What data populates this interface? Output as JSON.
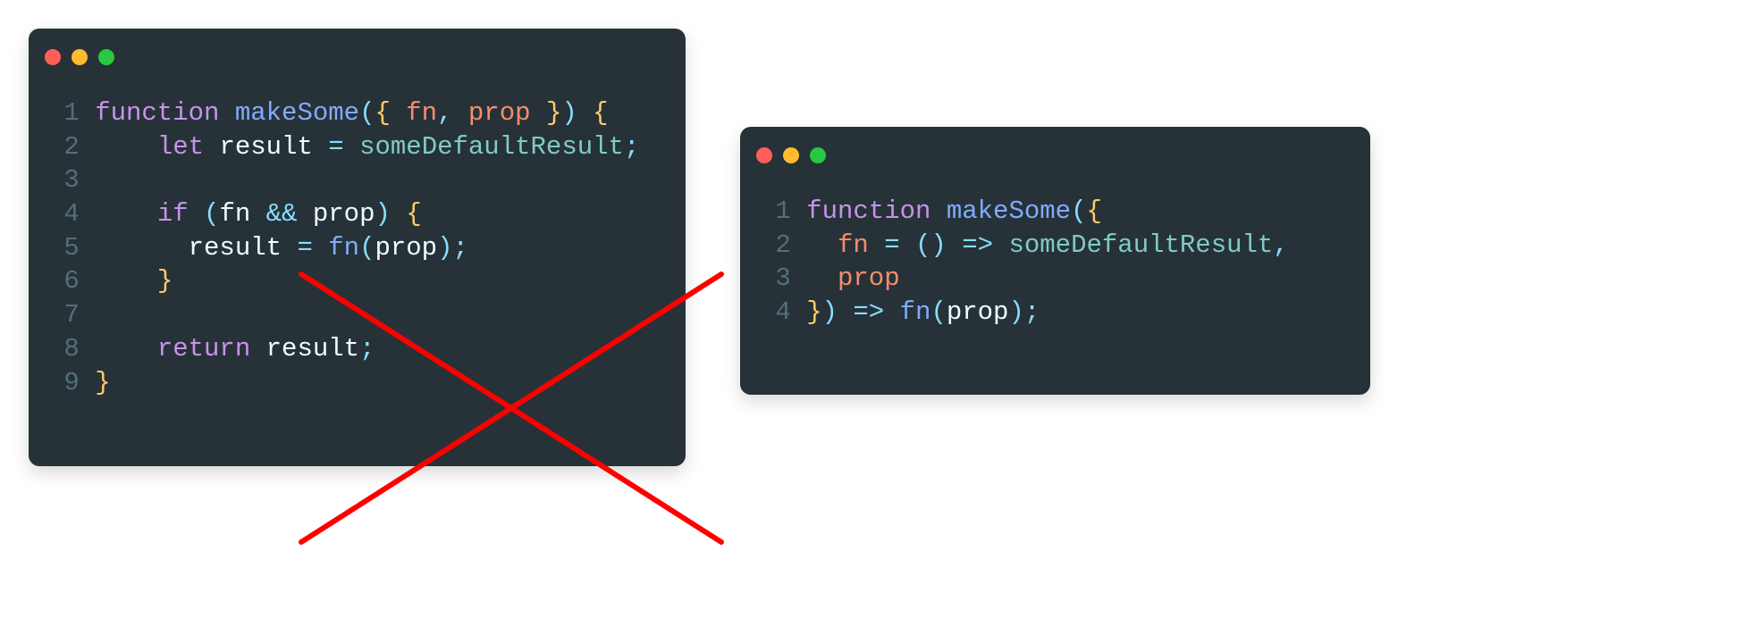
{
  "windows": {
    "left": {
      "titlebar_dots": [
        "close",
        "minimize",
        "zoom"
      ],
      "crossed_out": true,
      "code_lines": [
        {
          "n": 1,
          "tokens": [
            {
              "cls": "kw",
              "t": "function"
            },
            {
              "cls": "tok",
              "t": " "
            },
            {
              "cls": "fn",
              "t": "makeSome"
            },
            {
              "cls": "punct",
              "t": "("
            },
            {
              "cls": "brace",
              "t": "{"
            },
            {
              "cls": "tok",
              "t": " "
            },
            {
              "cls": "param",
              "t": "fn"
            },
            {
              "cls": "punct",
              "t": ","
            },
            {
              "cls": "tok",
              "t": " "
            },
            {
              "cls": "param",
              "t": "prop"
            },
            {
              "cls": "tok",
              "t": " "
            },
            {
              "cls": "brace",
              "t": "}"
            },
            {
              "cls": "punct",
              "t": ")"
            },
            {
              "cls": "tok",
              "t": " "
            },
            {
              "cls": "brace",
              "t": "{"
            }
          ]
        },
        {
          "n": 2,
          "tokens": [
            {
              "cls": "tok",
              "t": "    "
            },
            {
              "cls": "kw",
              "t": "let"
            },
            {
              "cls": "tok",
              "t": " "
            },
            {
              "cls": "id",
              "t": "result"
            },
            {
              "cls": "tok",
              "t": " "
            },
            {
              "cls": "punct",
              "t": "="
            },
            {
              "cls": "tok",
              "t": " "
            },
            {
              "cls": "var",
              "t": "someDefaultResult"
            },
            {
              "cls": "punct",
              "t": ";"
            }
          ]
        },
        {
          "n": 3,
          "tokens": [
            {
              "cls": "tok",
              "t": ""
            }
          ]
        },
        {
          "n": 4,
          "tokens": [
            {
              "cls": "tok",
              "t": "    "
            },
            {
              "cls": "kw",
              "t": "if"
            },
            {
              "cls": "tok",
              "t": " "
            },
            {
              "cls": "punct",
              "t": "("
            },
            {
              "cls": "id",
              "t": "fn"
            },
            {
              "cls": "tok",
              "t": " "
            },
            {
              "cls": "punct",
              "t": "&&"
            },
            {
              "cls": "tok",
              "t": " "
            },
            {
              "cls": "id",
              "t": "prop"
            },
            {
              "cls": "punct",
              "t": ")"
            },
            {
              "cls": "tok",
              "t": " "
            },
            {
              "cls": "brace",
              "t": "{"
            }
          ]
        },
        {
          "n": 5,
          "tokens": [
            {
              "cls": "tok",
              "t": "      "
            },
            {
              "cls": "id",
              "t": "result"
            },
            {
              "cls": "tok",
              "t": " "
            },
            {
              "cls": "punct",
              "t": "="
            },
            {
              "cls": "tok",
              "t": " "
            },
            {
              "cls": "call",
              "t": "fn"
            },
            {
              "cls": "punct",
              "t": "("
            },
            {
              "cls": "id",
              "t": "prop"
            },
            {
              "cls": "punct",
              "t": ")"
            },
            {
              "cls": "punct",
              "t": ";"
            }
          ]
        },
        {
          "n": 6,
          "tokens": [
            {
              "cls": "tok",
              "t": "    "
            },
            {
              "cls": "brace",
              "t": "}"
            }
          ]
        },
        {
          "n": 7,
          "tokens": [
            {
              "cls": "tok",
              "t": ""
            }
          ]
        },
        {
          "n": 8,
          "tokens": [
            {
              "cls": "tok",
              "t": "    "
            },
            {
              "cls": "ret",
              "t": "return"
            },
            {
              "cls": "tok",
              "t": " "
            },
            {
              "cls": "id",
              "t": "result"
            },
            {
              "cls": "punct",
              "t": ";"
            }
          ]
        },
        {
          "n": 9,
          "tokens": [
            {
              "cls": "brace",
              "t": "}"
            }
          ]
        }
      ]
    },
    "right": {
      "titlebar_dots": [
        "close",
        "minimize",
        "zoom"
      ],
      "code_lines": [
        {
          "n": 1,
          "tokens": [
            {
              "cls": "kw",
              "t": "function"
            },
            {
              "cls": "tok",
              "t": " "
            },
            {
              "cls": "fn",
              "t": "makeSome"
            },
            {
              "cls": "punct",
              "t": "("
            },
            {
              "cls": "brace",
              "t": "{"
            }
          ]
        },
        {
          "n": 2,
          "tokens": [
            {
              "cls": "tok",
              "t": "  "
            },
            {
              "cls": "param",
              "t": "fn"
            },
            {
              "cls": "tok",
              "t": " "
            },
            {
              "cls": "punct",
              "t": "="
            },
            {
              "cls": "tok",
              "t": " "
            },
            {
              "cls": "punct",
              "t": "()"
            },
            {
              "cls": "tok",
              "t": " "
            },
            {
              "cls": "punct",
              "t": "=>"
            },
            {
              "cls": "tok",
              "t": " "
            },
            {
              "cls": "var",
              "t": "someDefaultResult"
            },
            {
              "cls": "punct",
              "t": ","
            }
          ]
        },
        {
          "n": 3,
          "tokens": [
            {
              "cls": "tok",
              "t": "  "
            },
            {
              "cls": "param",
              "t": "prop"
            }
          ]
        },
        {
          "n": 4,
          "tokens": [
            {
              "cls": "brace",
              "t": "}"
            },
            {
              "cls": "punct",
              "t": ")"
            },
            {
              "cls": "tok",
              "t": " "
            },
            {
              "cls": "punct",
              "t": "=>"
            },
            {
              "cls": "tok",
              "t": " "
            },
            {
              "cls": "call",
              "t": "fn"
            },
            {
              "cls": "punct",
              "t": "("
            },
            {
              "cls": "id",
              "t": "prop"
            },
            {
              "cls": "punct",
              "t": ")"
            },
            {
              "cls": "punct",
              "t": ";"
            }
          ]
        }
      ]
    }
  }
}
